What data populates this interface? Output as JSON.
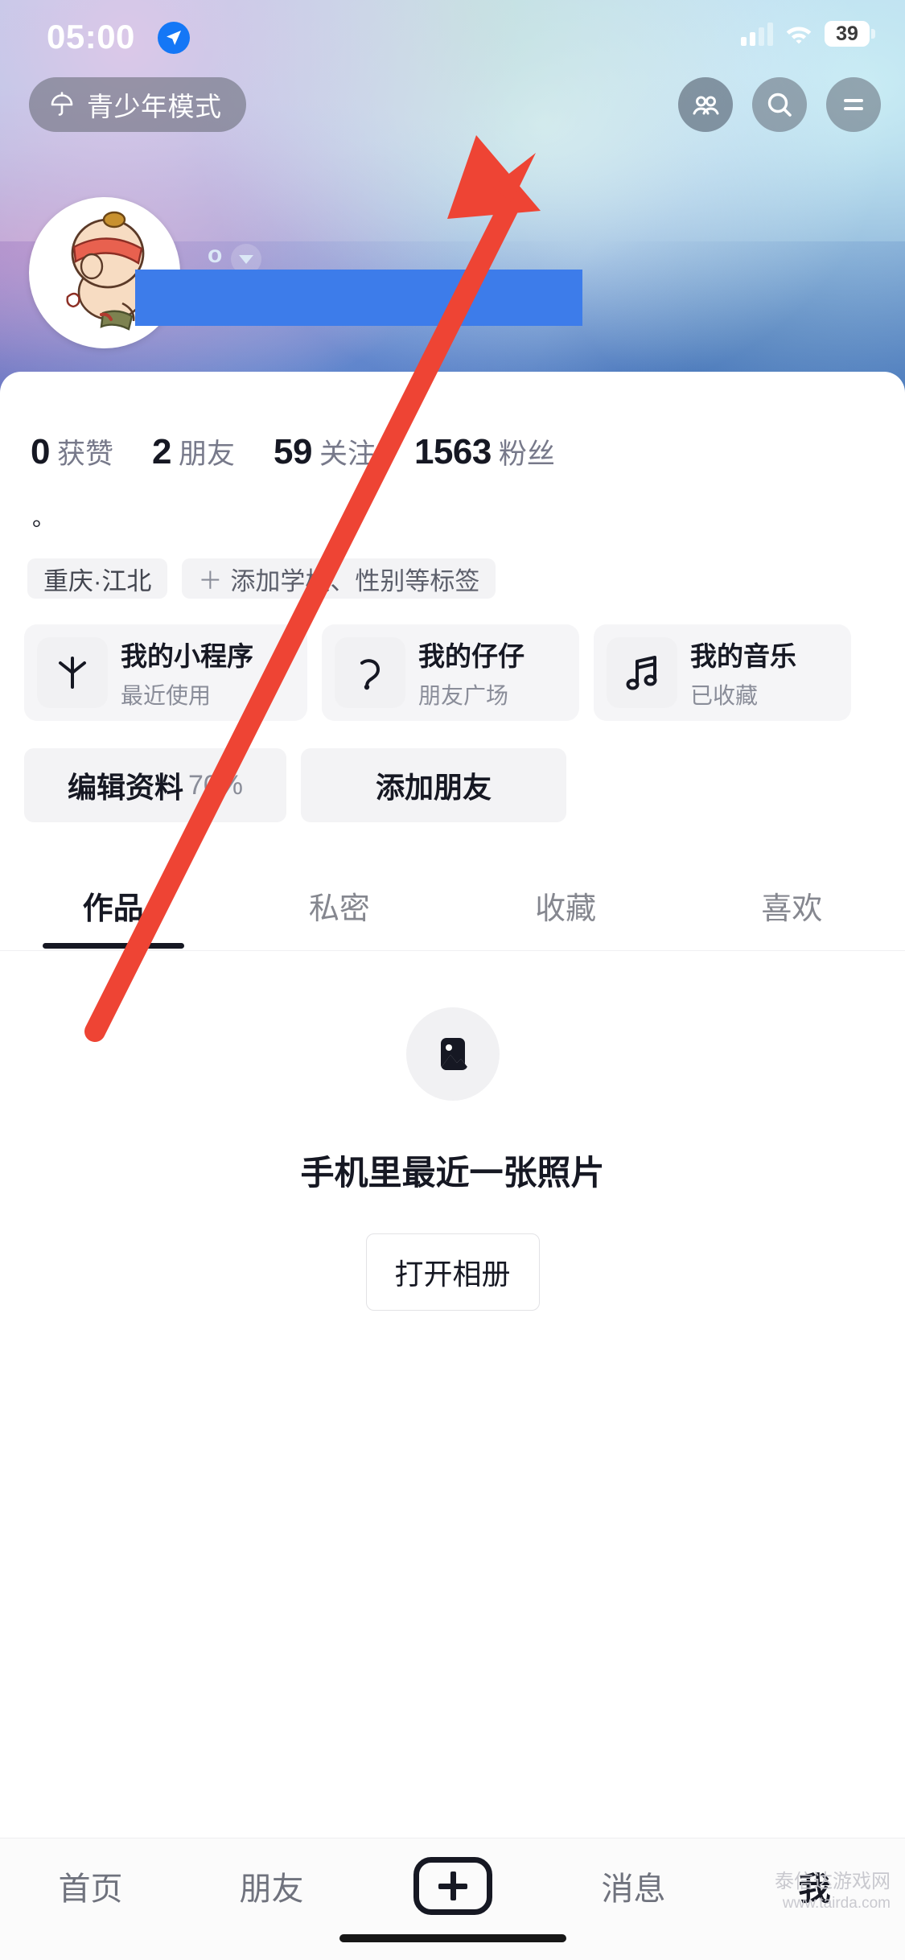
{
  "status_bar": {
    "time": "05:00",
    "location_icon": "location-arrow-icon",
    "signal_icon": "cellular-signal-icon",
    "wifi_icon": "wifi-icon",
    "battery_level": "39"
  },
  "top_nav": {
    "teen_mode_label": "青少年模式",
    "teen_mode_icon": "umbrella-icon",
    "friends_icon": "friends-icon",
    "search_icon": "search-icon",
    "menu_icon": "hamburger-menu-icon"
  },
  "profile": {
    "avatar_icon": "user-avatar",
    "name_redacted": "",
    "douyin_id_dot": "o",
    "caret_icon": "chevron-down-icon",
    "bio": "。",
    "stats": [
      {
        "num": "0",
        "label": "获赞"
      },
      {
        "num": "2",
        "label": "朋友"
      },
      {
        "num": "59",
        "label": "关注"
      },
      {
        "num": "1563",
        "label": "粉丝"
      }
    ],
    "tags": [
      {
        "text": "重庆·江北",
        "has_plus": false
      },
      {
        "text": "添加学校、性别等标签",
        "has_plus": true,
        "plus": "＋"
      }
    ]
  },
  "mini_cards": [
    {
      "icon": "mini-program-icon",
      "title": "我的小程序",
      "subtitle": "最近使用"
    },
    {
      "icon": "zaizai-icon",
      "title": "我的仔仔",
      "subtitle": "朋友广场"
    },
    {
      "icon": "music-note-icon",
      "title": "我的音乐",
      "subtitle": "已收藏"
    }
  ],
  "actions": {
    "edit_label": "编辑资料",
    "edit_percent": "70%",
    "add_friend_label": "添加朋友"
  },
  "tabs": [
    {
      "label": "作品",
      "active": true
    },
    {
      "label": "私密",
      "active": false
    },
    {
      "label": "收藏",
      "active": false
    },
    {
      "label": "喜欢",
      "active": false
    }
  ],
  "empty_state": {
    "icon": "photo-placeholder-icon",
    "title": "手机里最近一张照片",
    "button_label": "打开相册"
  },
  "bottom_nav": [
    {
      "label": "首页",
      "active": false
    },
    {
      "label": "朋友",
      "active": false
    },
    {
      "label": "＋",
      "active": false,
      "is_plus": true
    },
    {
      "label": "消息",
      "active": false
    },
    {
      "label": "我",
      "active": true
    }
  ],
  "annotation": {
    "type": "arrow",
    "color": "#ee4434",
    "points_to": "hamburger-menu-icon"
  },
  "watermark": {
    "line1": "泰信达游戏网",
    "line2": "www.tairda.com"
  },
  "colors": {
    "accent_blue": "#1477f6",
    "text_primary": "#161823",
    "text_secondary": "#8a8d99",
    "chip_bg": "#f3f3f5",
    "annotation_red": "#ee4434",
    "redaction_blue": "#3d7cea"
  }
}
